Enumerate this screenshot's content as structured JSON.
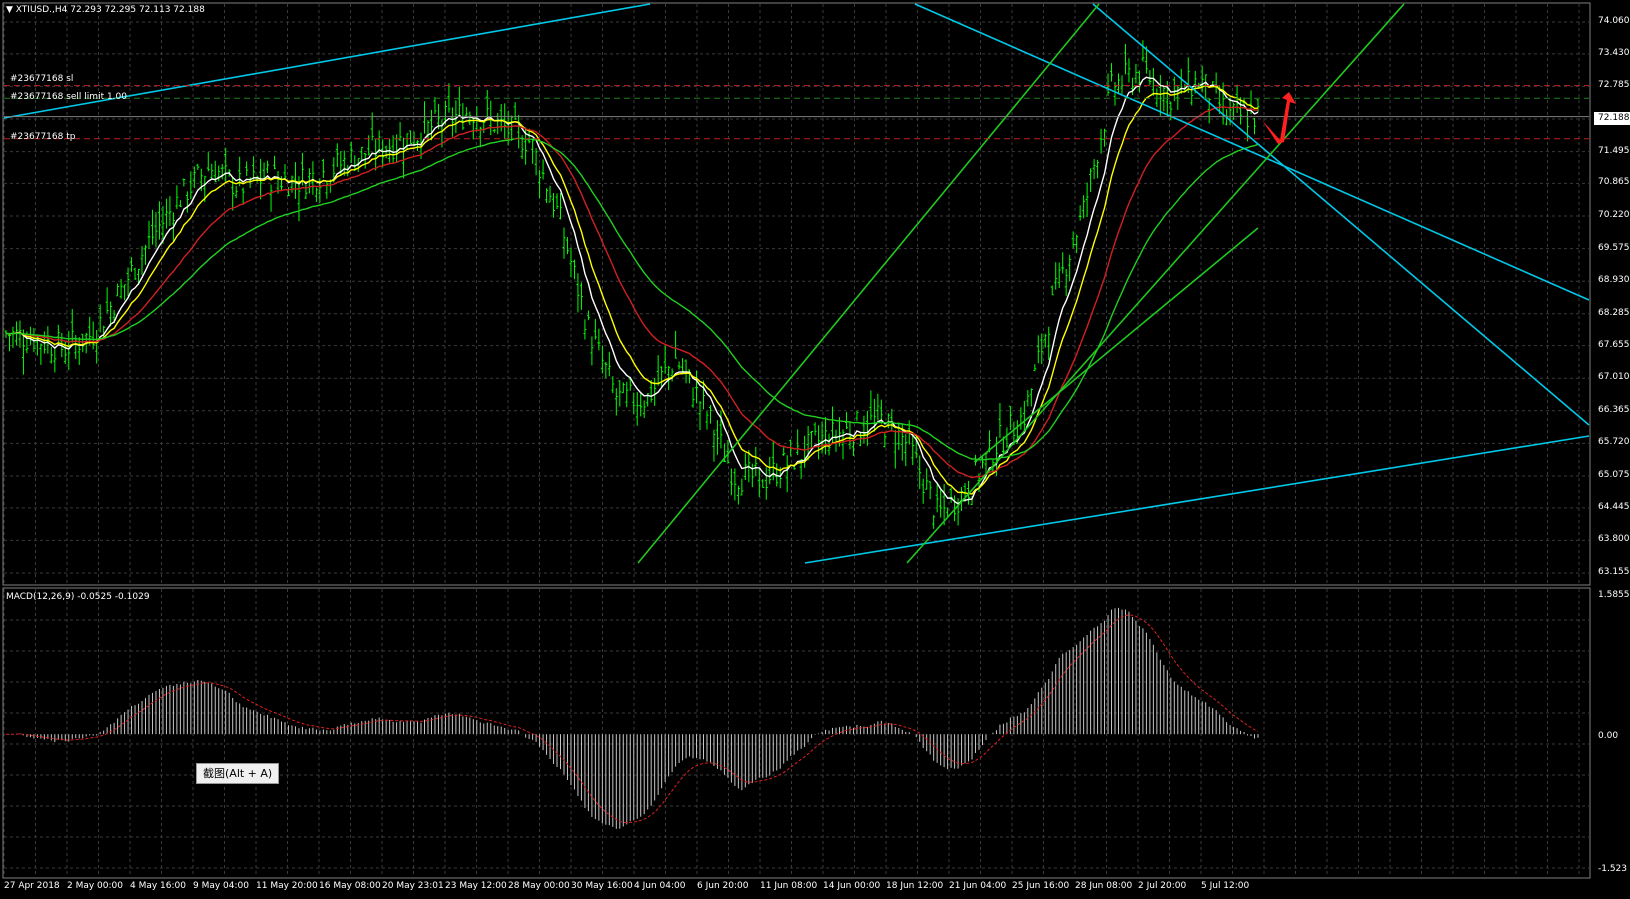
{
  "header": {
    "symbol_line": "▼ XTIUSD.,H4  72.293 72.295 72.113 72.188"
  },
  "orders": {
    "sl_label": "#23677168 sl",
    "sell_limit_label": "#23677168 sell limit 1.00",
    "tp_label": "#23677168 tp",
    "sl_price": 72.8,
    "entry_price": 72.55,
    "tp_price": 71.75
  },
  "current_price": "72.188",
  "price_axis": [
    "74.060",
    "73.430",
    "72.785",
    "72.140",
    "71.495",
    "70.865",
    "70.220",
    "69.575",
    "68.930",
    "68.285",
    "67.655",
    "67.010",
    "66.365",
    "65.720",
    "65.075",
    "64.445",
    "63.800",
    "63.155"
  ],
  "time_axis": [
    "27 Apr 2018",
    "2 May 00:00",
    "4 May 16:00",
    "9 May 04:00",
    "11 May 20:00",
    "16 May 08:00",
    "20 May 23:01",
    "23 May 12:00",
    "28 May 00:00",
    "30 May 16:00",
    "4 Jun 04:00",
    "6 Jun 20:00",
    "11 Jun 08:00",
    "14 Jun 00:00",
    "18 Jun 12:00",
    "21 Jun 04:00",
    "25 Jun 16:00",
    "28 Jun 08:00",
    "2 Jul 20:00",
    "5 Jul 12:00"
  ],
  "macd": {
    "label": "MACD(12,26,9) -0.0525 -0.1029",
    "axis_top": "1.5855",
    "axis_zero": "0.00",
    "axis_bottom": "-1.523"
  },
  "tooltip": "截图(Alt + A)",
  "colors": {
    "background": "#000000",
    "grid": "#3a3a3a",
    "candles": "#00ff00",
    "ma_white": "#ffffff",
    "ma_yellow": "#ffff00",
    "ma_red": "#d02020",
    "ma_green": "#20d020",
    "channel_cyan": "#00c8e8",
    "channel_green": "#20c820",
    "order_line": "#c02020"
  },
  "chart_data": {
    "type": "line",
    "title": "XTIUSD.,H4",
    "price_range": [
      63.155,
      74.06
    ],
    "series": [
      {
        "name": "close",
        "values": [
          67.9,
          67.8,
          67.6,
          67.9,
          68.8,
          69.8,
          70.6,
          71.2,
          70.8,
          71.0,
          70.9,
          71.1,
          71.4,
          71.6,
          71.8,
          72.1,
          72.3,
          72.0,
          71.7,
          70.2,
          68.0,
          66.6,
          66.6,
          67.4,
          66.4,
          65.1,
          65.0,
          65.4,
          65.8,
          66.0,
          66.2,
          65.7,
          64.3,
          64.8,
          65.7,
          66.3,
          68.6,
          70.3,
          72.8,
          73.1,
          72.6,
          72.9,
          72.2,
          72.188
        ]
      }
    ],
    "macd": {
      "label": "MACD(12,26,9)",
      "macd_value": -0.0525,
      "signal_value": -0.1029,
      "range": [
        -1.523,
        1.5855
      ]
    }
  }
}
